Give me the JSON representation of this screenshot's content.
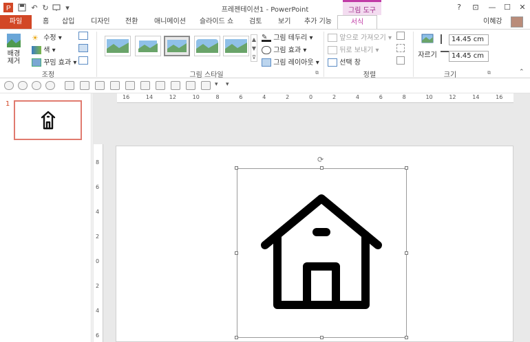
{
  "window": {
    "title": "프레젠테이션1 - PowerPoint",
    "context_group": "그림 도구",
    "help": "?",
    "ribbon_display": "⊡",
    "minimize": "—",
    "maximize": "☐",
    "close": "✕"
  },
  "tabs": {
    "file": "파일",
    "home": "홈",
    "insert": "삽입",
    "design": "디자인",
    "transitions": "전환",
    "animations": "애니메이션",
    "slideshow": "슬라이드 쇼",
    "review": "검토",
    "view": "보기",
    "addins": "추가 기능",
    "format": "서식",
    "user": "이혜강"
  },
  "ribbon": {
    "adjust": {
      "remove_bg": "배경\n제거",
      "corrections": "수정",
      "color": "색",
      "artistic": "꾸밈 효과",
      "label": "조정"
    },
    "styles": {
      "border": "그림 테두리",
      "effects": "그림 효과",
      "layout": "그림 레이아웃",
      "label": "그림 스타일"
    },
    "arrange": {
      "bring_forward": "앞으로 가져오기",
      "send_backward": "뒤로 보내기",
      "selection_pane": "선택 창",
      "label": "정렬"
    },
    "size": {
      "crop": "자르기",
      "height": "14.45 cm",
      "width": "14.45 cm",
      "label": "크기"
    }
  },
  "ruler": {
    "h_ticks": [
      "16",
      "14",
      "12",
      "10",
      "8",
      "6",
      "4",
      "2",
      "0",
      "2",
      "4",
      "6",
      "8",
      "10",
      "12",
      "14",
      "16"
    ],
    "v_ticks": [
      "8",
      "6",
      "4",
      "2",
      "0",
      "2",
      "4",
      "6"
    ]
  },
  "slides_pane": {
    "slide_number": "1"
  },
  "colors": {
    "file_tab": "#d24726",
    "context_accent": "#c03aa6",
    "thumb_border": "#e07a6e"
  },
  "icons": {
    "main_image": "house-icon",
    "thumb_image": "house-icon"
  }
}
